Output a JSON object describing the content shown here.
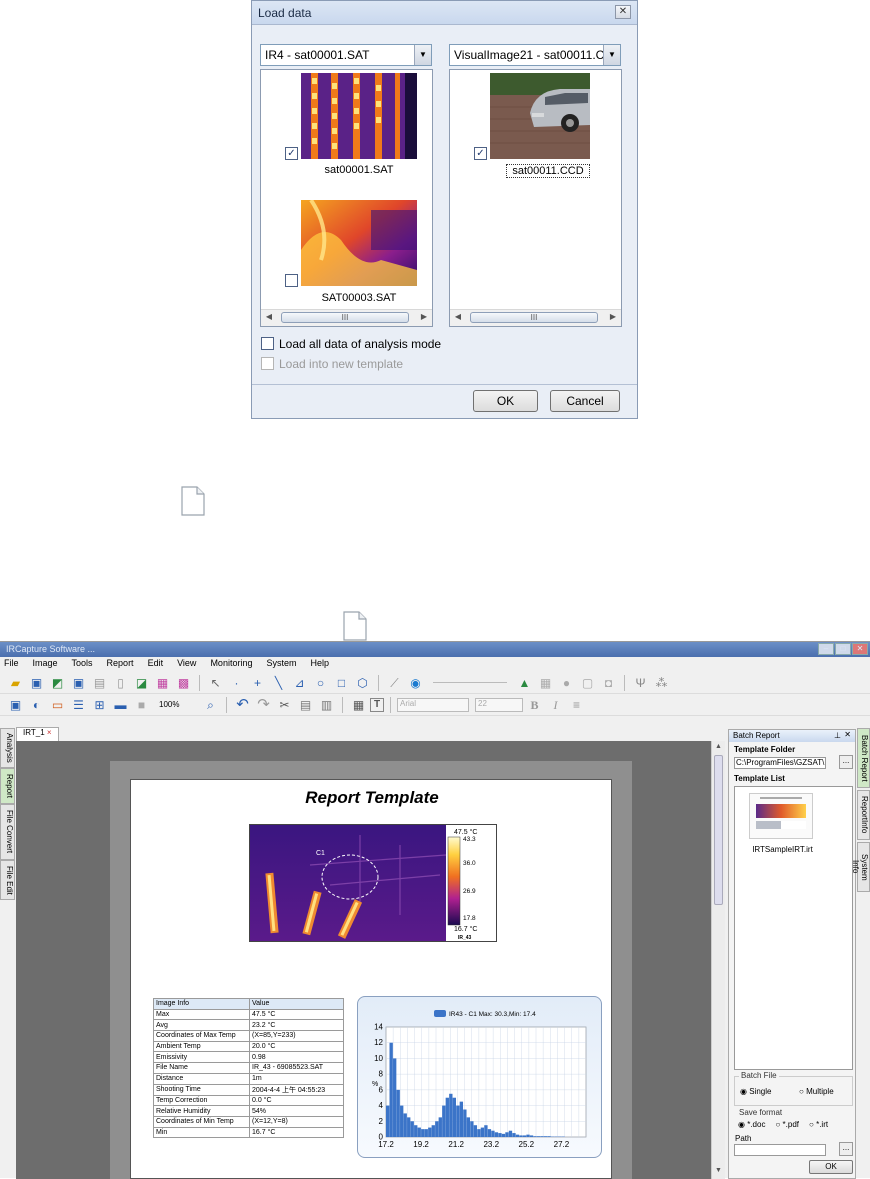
{
  "dialog": {
    "title": "Load data",
    "close_glyph": "✕",
    "left_combo": "IR4 - sat00001.SAT",
    "right_combo": "VisualImage21 - sat00011.C",
    "left_items": [
      {
        "label": "sat00001.SAT",
        "checked": true
      },
      {
        "label": "SAT00003.SAT",
        "checked": false
      }
    ],
    "right_items": [
      {
        "label": "sat00011.CCD",
        "checked": true
      }
    ],
    "scroll_thumb_glyph": "III",
    "load_all_label": "Load all data of analysis mode",
    "load_new_template_label": "Load into new template",
    "ok_label": "OK",
    "cancel_label": "Cancel"
  },
  "app": {
    "title": "IRCapture Software ...",
    "menu": [
      "File",
      "Image",
      "Tools",
      "Report",
      "Edit",
      "View",
      "Monitoring",
      "System",
      "Help"
    ],
    "zoom": "100%",
    "font_name": "Arial",
    "font_size": "22",
    "doc_tab": "IRT_1",
    "left_tabs": [
      "Analysis",
      "Report",
      "File Convert",
      "File Edit"
    ],
    "right_tabs": [
      "Batch Report",
      "ReportInfo",
      "System Info"
    ],
    "report": {
      "title": "Report Template",
      "spot_label": "C1",
      "scale_max": "47.5 °C",
      "scale_ticks": [
        "43.3",
        "36.0",
        "26.9",
        "17.8"
      ],
      "scale_min": "16.7 °C",
      "image_name": "IR_43",
      "info_header": [
        "Image Info",
        "Value"
      ],
      "info_rows": [
        [
          "Max",
          "47.5 °C"
        ],
        [
          "Avg",
          "23.2 °C"
        ],
        [
          "Coordinates of Max Temp",
          "(X=85,Y=233)"
        ],
        [
          "Ambient Temp",
          "20.0 °C"
        ],
        [
          "Emissivity",
          "0.98"
        ],
        [
          "File Name",
          "IR_43 - 69085523.SAT"
        ],
        [
          "Distance",
          "1m"
        ],
        [
          "Shooting Time",
          "2004-4-4 上午 04:55:23"
        ],
        [
          "Temp Correction",
          "0.0 °C"
        ],
        [
          "Relative Humidity",
          "54%"
        ],
        [
          "Coordinates of Min Temp",
          "(X=12,Y=8)"
        ],
        [
          "Min",
          "16.7 °C"
        ]
      ]
    },
    "batch": {
      "panel_title": "Batch Report",
      "template_folder_label": "Template Folder",
      "template_folder_value": "C:\\ProgramFiles\\GZSAT\\I",
      "template_list_label": "Template List",
      "template_item": "IRTSampleIRT.irt",
      "batch_file_label": "Batch File",
      "single_label": "Single",
      "multiple_label": "Multiple",
      "save_format_label": "Save format",
      "formats": [
        "*.doc",
        "*.pdf",
        "*.irt"
      ],
      "path_label": "Path",
      "browse_label": "...",
      "ok_label": "OK"
    }
  },
  "chart_data": {
    "type": "bar",
    "legend": "IR43 - C1 Max: 30.3,Min: 17.4",
    "ylabel": "%",
    "xlim": [
      17.2,
      28.6
    ],
    "ylim": [
      0,
      14
    ],
    "x_ticks": [
      "17.2",
      "19.2",
      "21.2",
      "23.2",
      "25.2",
      "27.2"
    ],
    "y_ticks": [
      "0",
      "2",
      "4",
      "6",
      "8",
      "10",
      "12",
      "14"
    ],
    "x": [
      17.2,
      17.4,
      17.6,
      17.8,
      18.0,
      18.2,
      18.4,
      18.6,
      18.8,
      19.0,
      19.2,
      19.4,
      19.6,
      19.8,
      20.0,
      20.2,
      20.4,
      20.6,
      20.8,
      21.0,
      21.2,
      21.4,
      21.6,
      21.8,
      22.0,
      22.2,
      22.4,
      22.6,
      22.8,
      23.0,
      23.2,
      23.4,
      23.6,
      23.8,
      24.0,
      24.2,
      24.4,
      24.6,
      24.8,
      25.0,
      25.2,
      25.4,
      25.6,
      25.8,
      26.0,
      26.2,
      26.4,
      26.6,
      26.8,
      27.0,
      27.2
    ],
    "values": [
      4,
      12,
      10,
      6,
      4,
      3,
      2.5,
      2,
      1.5,
      1.2,
      1,
      1,
      1.2,
      1.5,
      2,
      2.5,
      4,
      5,
      5.5,
      5,
      4,
      4.5,
      3.5,
      2.5,
      2,
      1.5,
      1,
      1.2,
      1.5,
      1,
      0.8,
      0.6,
      0.5,
      0.4,
      0.6,
      0.8,
      0.5,
      0.3,
      0.2,
      0.2,
      0.3,
      0.2,
      0.1,
      0.1,
      0.1,
      0.1,
      0.1,
      0.05,
      0.05,
      0.05,
      0.05
    ]
  }
}
